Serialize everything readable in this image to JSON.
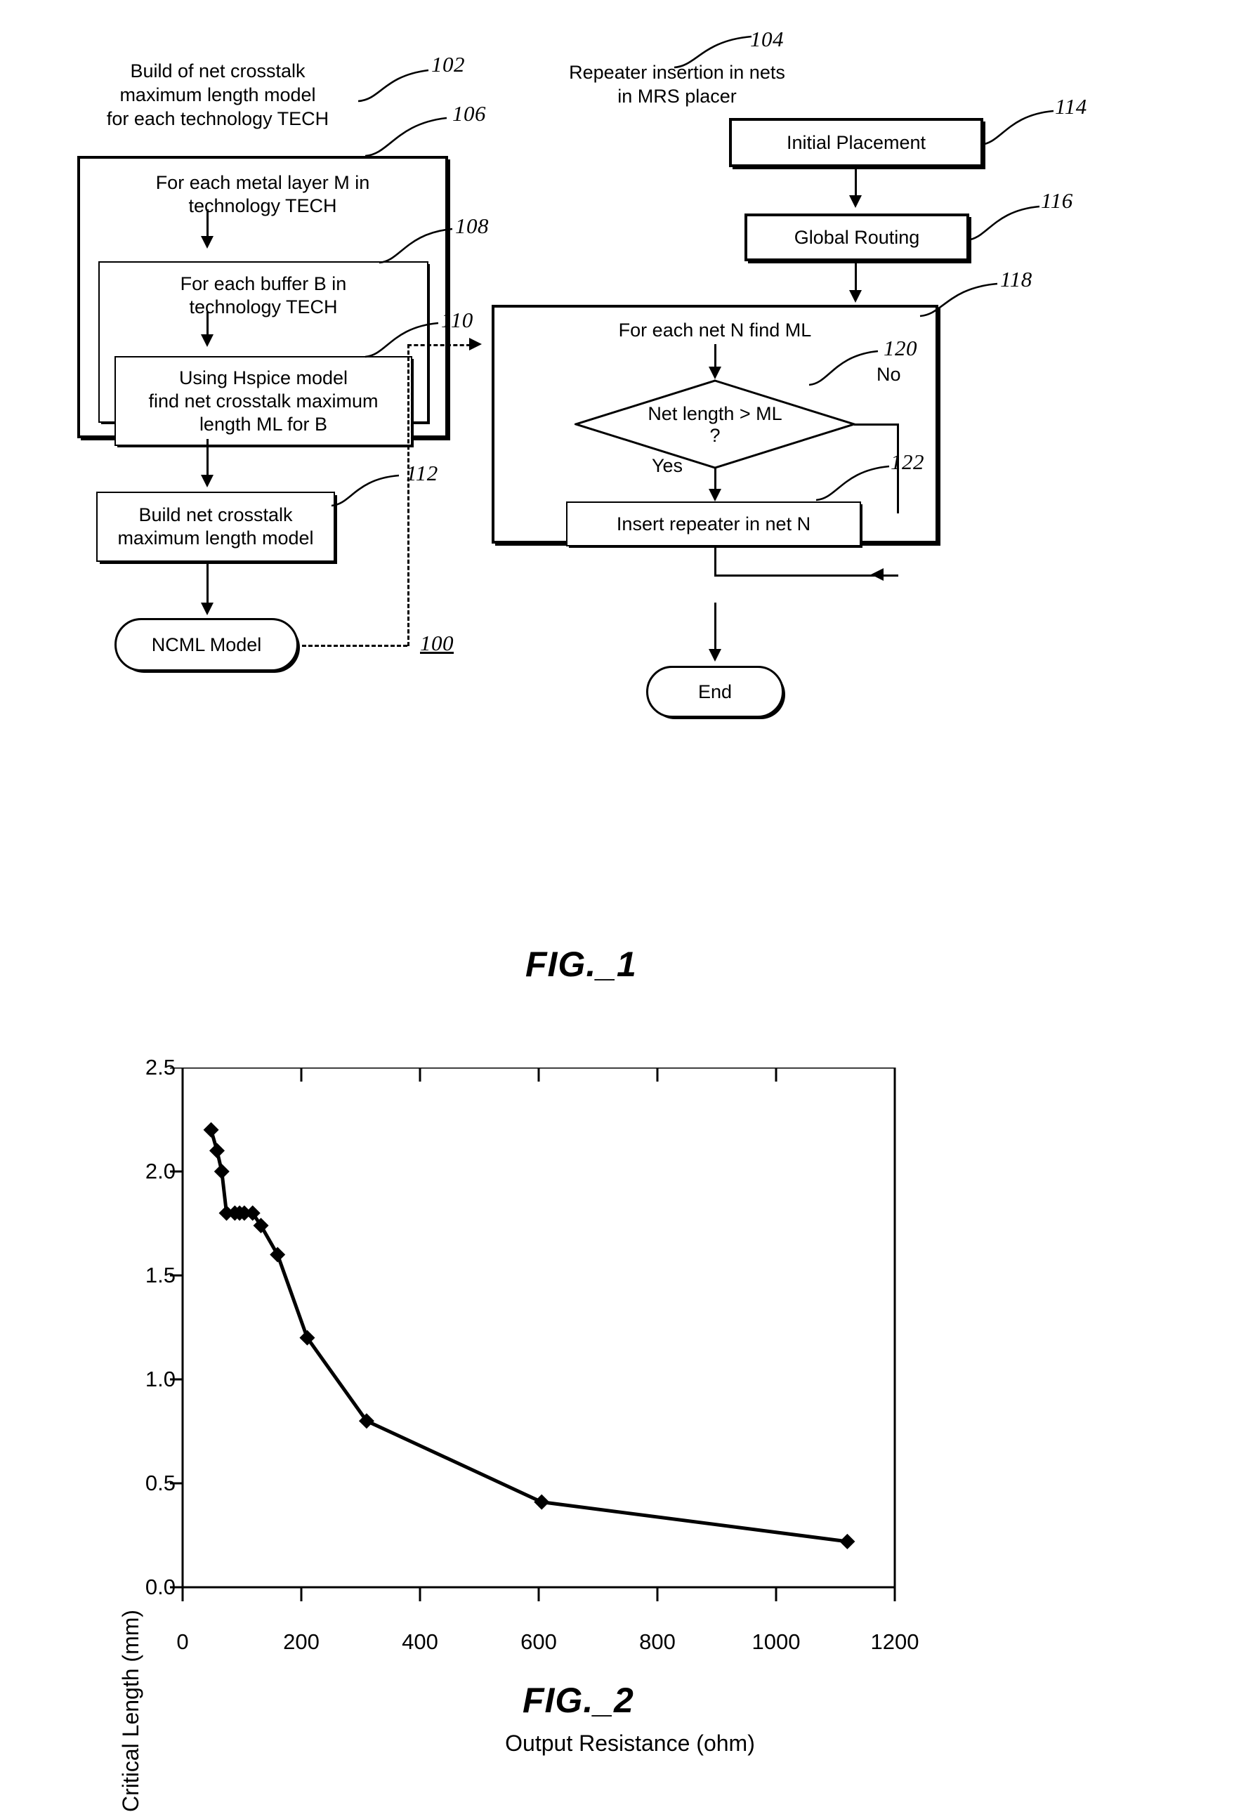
{
  "sheet": {
    "figure1": {
      "label": "FIG._1",
      "overall_ref": "100",
      "left_branch": {
        "caption": "Build of net crosstalk\nmaximum length model\nfor each technology TECH",
        "caption_ref": "102",
        "outer_loop": {
          "ref": "106",
          "text": "For each metal layer M in\ntechnology TECH"
        },
        "middle_loop": {
          "ref": "108",
          "text": "For each buffer B in\ntechnology TECH"
        },
        "inner_step": {
          "ref": "110",
          "text": "Using Hspice model\nfind net crosstalk maximum\nlength ML for B"
        },
        "build_step": {
          "ref": "112",
          "text": "Build net crosstalk\nmaximum length model"
        },
        "output": {
          "text": "NCML Model"
        }
      },
      "right_branch": {
        "caption": "Repeater insertion in nets\nin MRS placer",
        "caption_ref": "104",
        "initial_placement": {
          "ref": "114",
          "text": "Initial Placement"
        },
        "global_routing": {
          "ref": "116",
          "text": "Global Routing"
        },
        "net_loop": {
          "ref": "118",
          "text": "For each net N find ML"
        },
        "decision": {
          "ref": "120",
          "text": "Net length > ML\n?",
          "yes_label": "Yes",
          "no_label": "No"
        },
        "insert_step": {
          "ref": "122",
          "text": "Insert repeater in net N"
        },
        "end": {
          "text": "End"
        }
      }
    },
    "figure2": {
      "label": "FIG._2",
      "chart_data": {
        "type": "line",
        "title": "",
        "xlabel": "Output Resistance (ohm)",
        "ylabel": "Critical Length (mm)",
        "xlim": [
          0,
          1200
        ],
        "ylim": [
          0,
          2.5
        ],
        "xticks": [
          0,
          200,
          400,
          600,
          800,
          1000,
          1200
        ],
        "yticks": [
          0.0,
          0.5,
          1.0,
          1.5,
          2.0,
          2.5
        ],
        "xticklabels": [
          "0",
          "200",
          "400",
          "600",
          "800",
          "1000",
          "1200"
        ],
        "yticklabels": [
          "0.0",
          "0.5",
          "1.0",
          "1.5",
          "2.0",
          "2.5"
        ],
        "grid": false,
        "legend": null,
        "marker": "diamond",
        "series": [
          {
            "name": "Critical Length",
            "x": [
              48,
              58,
              66,
              74,
              88,
              96,
              104,
              118,
              132,
              160,
              210,
              310,
              605,
              1120
            ],
            "y": [
              2.2,
              2.1,
              2.0,
              1.8,
              1.8,
              1.8,
              1.8,
              1.8,
              1.74,
              1.6,
              1.2,
              0.8,
              0.41,
              0.22
            ]
          }
        ]
      }
    }
  }
}
